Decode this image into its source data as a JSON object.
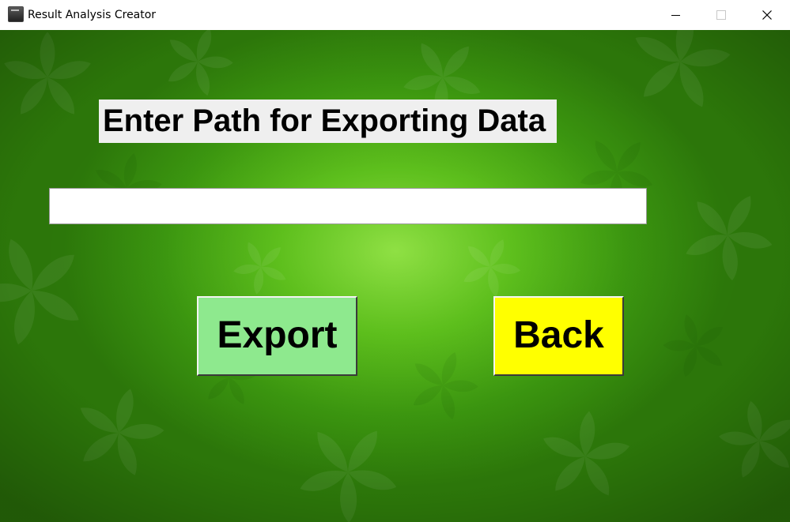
{
  "window": {
    "title": "Result Analysis Creator",
    "icon": "app-window-icon",
    "controls": {
      "minimize_icon": "minimize-icon",
      "maximize_icon": "maximize-icon",
      "close_icon": "close-icon"
    }
  },
  "form": {
    "heading": "Enter Path for Exporting Data",
    "path_input": {
      "value": "",
      "placeholder": ""
    },
    "export_label": "Export",
    "back_label": "Back"
  },
  "colors": {
    "background": "#4fb31a",
    "heading_bg": "#efefef",
    "export_button": "#8ee98e",
    "back_button": "#ffff00"
  }
}
